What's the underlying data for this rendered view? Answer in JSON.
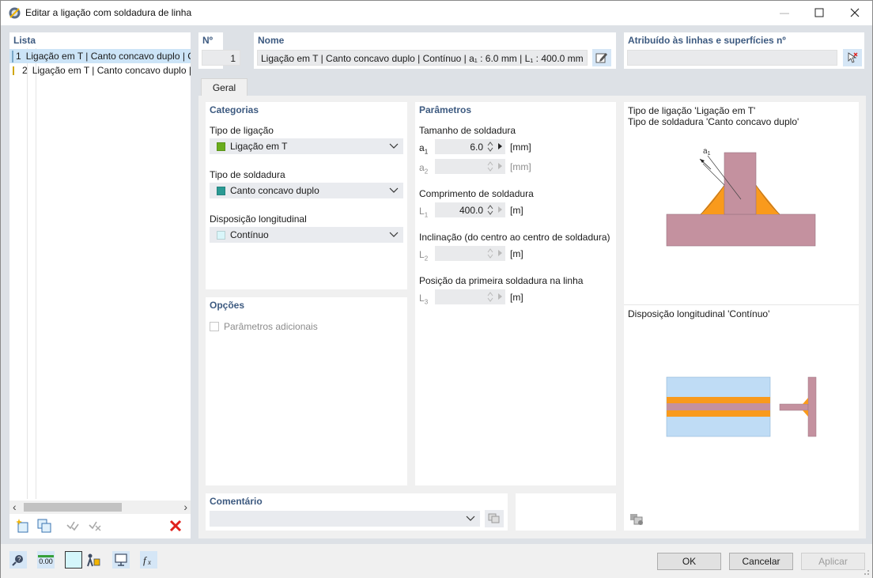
{
  "window": {
    "title": "Editar a ligação com soldadura de linha",
    "minimize_glyph": "—",
    "maximize_glyph": "☐",
    "close_glyph": "✕"
  },
  "list": {
    "header": "Lista",
    "items": [
      {
        "no": "1",
        "label": "Ligação em T | Canto concavo duplo | Contínuo",
        "color": "#a6d2ee",
        "selected": true
      },
      {
        "no": "2",
        "label": "Ligação em T | Canto concavo duplo | Contínuo",
        "color": "#f5c518",
        "selected": false
      }
    ],
    "scroll_left": "‹",
    "scroll_right": "›"
  },
  "number": {
    "header": "Nº",
    "value": "1"
  },
  "name": {
    "header": "Nome",
    "value": "Ligação em T | Canto concavo duplo | Contínuo | a₁ : 6.0 mm | L₁ : 400.0 mm"
  },
  "assigned": {
    "header": "Atribuído às linhas e superfícies nº",
    "value": ""
  },
  "tabs": [
    {
      "label": "Geral",
      "active": true
    }
  ],
  "categories": {
    "header": "Categorias",
    "connection_type": {
      "label": "Tipo de ligação",
      "value": "Ligação em T",
      "color": "#6aad1e"
    },
    "weld_type": {
      "label": "Tipo de soldadura",
      "value": "Canto concavo duplo",
      "color": "#2a9a94"
    },
    "longitudinal": {
      "label": "Disposição longitudinal",
      "value": "Contínuo",
      "color": "#d9f6fa"
    }
  },
  "options": {
    "header": "Opções",
    "additional_params": {
      "label": "Parâmetros adicionais",
      "checked": false
    }
  },
  "parameters": {
    "header": "Parâmetros",
    "weld_size": {
      "label": "Tamanho de soldadura",
      "a1": {
        "symbol": "a1",
        "value": "6.0",
        "unit": "[mm]"
      },
      "a2": {
        "symbol": "a2",
        "value": "",
        "unit": "[mm]"
      }
    },
    "weld_length": {
      "label": "Comprimento de soldadura",
      "L1": {
        "symbol": "L1",
        "value": "400.0",
        "unit": "[m]"
      }
    },
    "inclination": {
      "label": "Inclinação (do centro ao centro de soldadura)",
      "L2": {
        "symbol": "L2",
        "value": "",
        "unit": "[m]"
      }
    },
    "first_position": {
      "label": "Posição da primeira soldadura na linha",
      "L3": {
        "symbol": "L3",
        "value": "",
        "unit": "[m]"
      }
    }
  },
  "preview": {
    "line1": "Tipo de ligação 'Ligação em T'",
    "line2": "Tipo de soldadura 'Canto concavo duplo'",
    "dim_label": "a",
    "dim_sub": "1",
    "longitudinal_caption": "Disposição longitudinal 'Contínuo'",
    "colors": {
      "plate": "#c4919f",
      "weld": "#f99a1c",
      "blue_plate": "#bfdcf5"
    }
  },
  "comment": {
    "header": "Comentário",
    "value": ""
  },
  "buttons": {
    "ok": "OK",
    "cancel": "Cancelar",
    "apply": "Aplicar"
  },
  "status_toolbar": {
    "value_display": "0.00"
  }
}
